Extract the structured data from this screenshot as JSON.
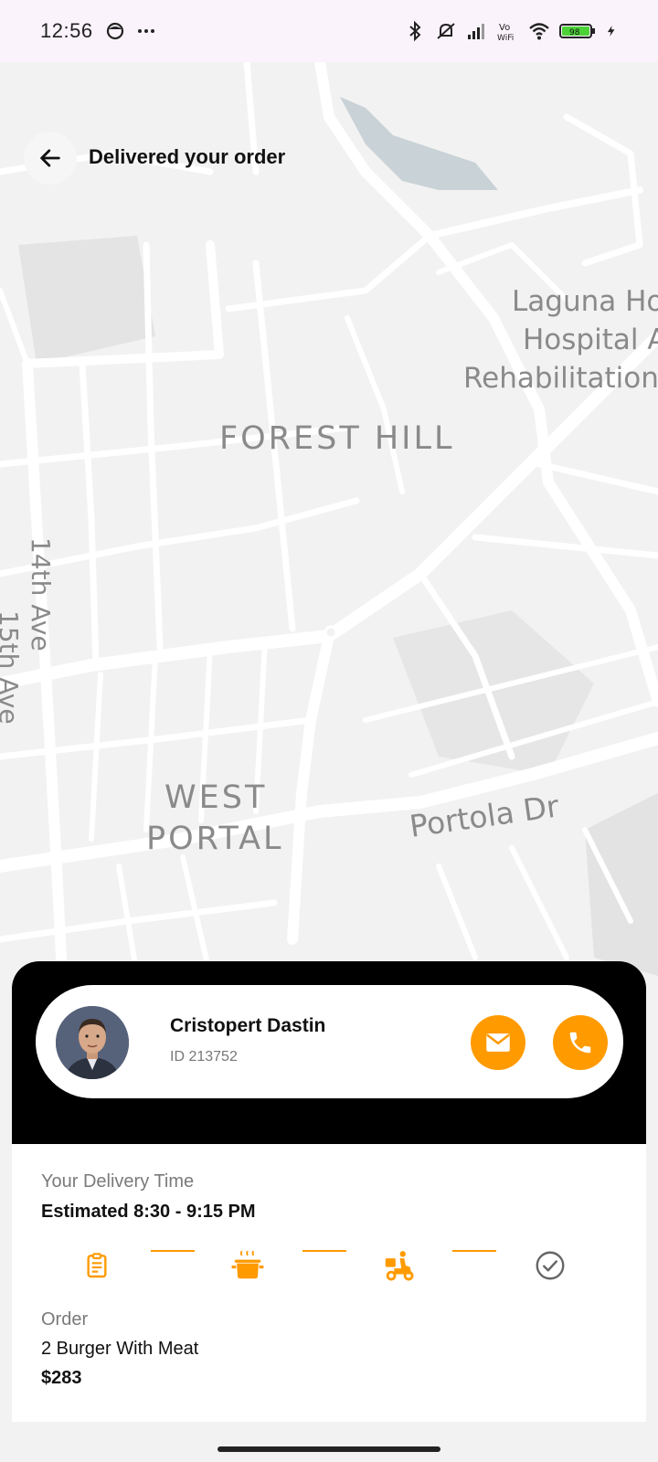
{
  "status_bar": {
    "time": "12:56",
    "battery": "98",
    "icons": [
      "face-icon",
      "more-dots-icon",
      "bluetooth-icon",
      "mute-icon",
      "signal-icon",
      "vowifi-icon",
      "wifi-icon",
      "battery-icon",
      "charging-icon"
    ]
  },
  "header": {
    "title": "Delivered your order",
    "back_icon": "arrow-left-icon"
  },
  "map": {
    "labels": {
      "forest_hill": "FOREST HILL",
      "west": "WEST",
      "portal": "PORTAL",
      "portola": "Portola Dr",
      "ave14": "14th Ave",
      "ave15": "15th Ave",
      "laguna1": "Laguna Ho",
      "laguna2": "Hospital A",
      "laguna3": "Rehabilitation"
    }
  },
  "driver": {
    "name": "Cristopert Dastin",
    "id": "ID 213752",
    "mail_icon": "mail-icon",
    "call_icon": "phone-icon"
  },
  "delivery": {
    "label": "Your Delivery Time",
    "estimate": "Estimated 8:30 - 9:15 PM",
    "steps": [
      "clipboard-icon",
      "cooking-pot-icon",
      "delivery-scooter-icon",
      "check-circle-icon"
    ]
  },
  "order": {
    "label": "Order",
    "items": "2 Burger With Meat",
    "price": "$283"
  },
  "colors": {
    "accent": "#ff9a00",
    "card_top": "#000000",
    "map_bg": "#f2f2f2"
  }
}
